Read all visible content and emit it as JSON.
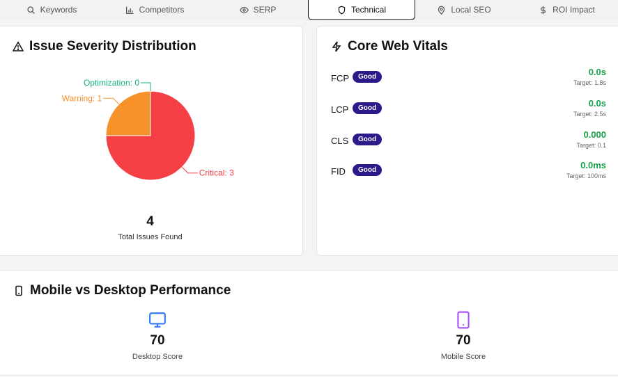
{
  "tabs": [
    {
      "label": "Keywords",
      "icon": "search-icon"
    },
    {
      "label": "Competitors",
      "icon": "bar-chart-icon"
    },
    {
      "label": "SERP",
      "icon": "eye-icon"
    },
    {
      "label": "Technical",
      "icon": "shield-icon",
      "active": true
    },
    {
      "label": "Local SEO",
      "icon": "map-pin-icon"
    },
    {
      "label": "ROI Impact",
      "icon": "dollar-icon"
    }
  ],
  "severity": {
    "title": "Issue Severity Distribution",
    "total_value": "4",
    "total_label": "Total Issues Found"
  },
  "chart_data": {
    "type": "pie",
    "categories": [
      "Critical",
      "Warning",
      "Optimization"
    ],
    "values": [
      3,
      1,
      0
    ],
    "labels": [
      "Critical: 3",
      "Warning: 1",
      "Optimization: 0"
    ],
    "colors": [
      "#f43f45",
      "#f7922b",
      "#12b07a"
    ]
  },
  "cwv": {
    "title": "Core Web Vitals",
    "metrics": [
      {
        "name": "FCP",
        "status": "Good",
        "value": "0.0s",
        "target": "Target: 1.8s"
      },
      {
        "name": "LCP",
        "status": "Good",
        "value": "0.0s",
        "target": "Target: 2.5s"
      },
      {
        "name": "CLS",
        "status": "Good",
        "value": "0.000",
        "target": "Target: 0.1"
      },
      {
        "name": "FID",
        "status": "Good",
        "value": "0.0ms",
        "target": "Target: 100ms"
      }
    ]
  },
  "performance": {
    "title": "Mobile vs Desktop Performance",
    "desktop": {
      "value": "70",
      "label": "Desktop Score",
      "color": "#2f7df6"
    },
    "mobile": {
      "value": "70",
      "label": "Mobile Score",
      "color": "#a855f7"
    }
  }
}
